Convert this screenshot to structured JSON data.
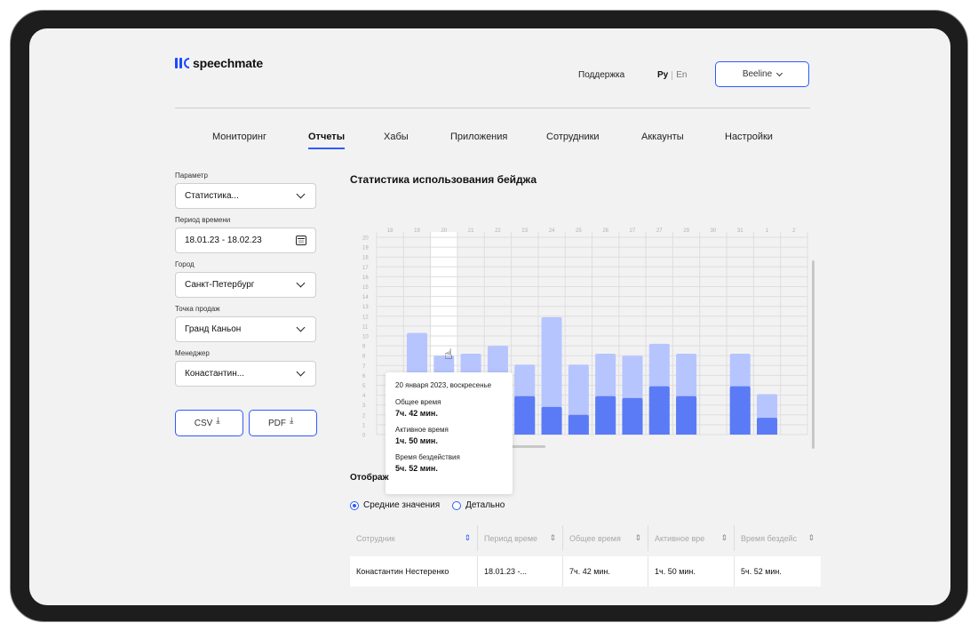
{
  "app": {
    "logo_text": "speechmate"
  },
  "header": {
    "support": "Поддержка",
    "lang_active": "Ру",
    "lang_other": "En",
    "account": "Beeline"
  },
  "nav": [
    "Мониторинг",
    "Отчеты",
    "Хабы",
    "Приложения",
    "Сотрудники",
    "Аккаунты",
    "Настройки"
  ],
  "filters": {
    "parameter_label": "Параметр",
    "parameter_value": "Статистика...",
    "period_label": "Период времени",
    "period_value": "18.01.23 - 18.02.23",
    "city_label": "Город",
    "city_value": "Санкт-Петербург",
    "point_label": "Точка продаж",
    "point_value": "Гранд Каньон",
    "manager_label": "Менеджер",
    "manager_value": "Конастантин..."
  },
  "exports": {
    "csv": "CSV",
    "pdf": "PDF"
  },
  "chart_title": "Статистика использования бейджа",
  "chart_data": {
    "type": "bar",
    "categories": [
      "18",
      "19",
      "20",
      "21",
      "22",
      "23",
      "24",
      "25",
      "26",
      "27",
      "27",
      "29",
      "30",
      "31",
      "1",
      "2"
    ],
    "y_ticks": [
      0,
      1,
      2,
      3,
      4,
      5,
      6,
      7,
      8,
      9,
      10,
      11,
      12,
      13,
      14,
      15,
      16,
      17,
      18,
      19,
      20
    ],
    "ylim": [
      0,
      20
    ],
    "series": [
      {
        "values": [
          null,
          10.3,
          8,
          8.2,
          9,
          7.1,
          11.9,
          7.1,
          8.2,
          8,
          9.2,
          8.2,
          null,
          8.2,
          4.1,
          null
        ],
        "color": "#b7c5ff"
      },
      {
        "values": [
          null,
          1.9,
          1.9,
          null,
          null,
          3.9,
          2.8,
          2,
          3.9,
          3.7,
          4.9,
          3.9,
          null,
          4.9,
          1.7,
          null
        ],
        "color": "#5b7bf6"
      }
    ],
    "highlighted_category_index": 2
  },
  "tooltip": {
    "date": "20 января 2023, воскресенье",
    "total_label": "Общее время",
    "total_value": "7ч. 42 мин.",
    "active_label": "Активное время",
    "active_value": "1ч. 50 мин.",
    "idle_label": "Время бездействия",
    "idle_value": "5ч. 52 мин."
  },
  "display_label": "Отображ",
  "radios": {
    "average": "Средние значения",
    "detailed": "Детально"
  },
  "table": {
    "headers": [
      "Сотрудник",
      "Период време",
      "Общее время",
      "Активное вре",
      "Время бездейс"
    ],
    "rows": [
      [
        "Конастантин Нестеренко",
        "18.01.23 -...",
        "7ч. 42 мин.",
        "1ч. 50 мин.",
        "5ч. 52 мин."
      ]
    ]
  },
  "colors": {
    "accent": "#2f5bff",
    "bar_total": "#b7c5ff",
    "bar_active": "#5b7bf6"
  }
}
